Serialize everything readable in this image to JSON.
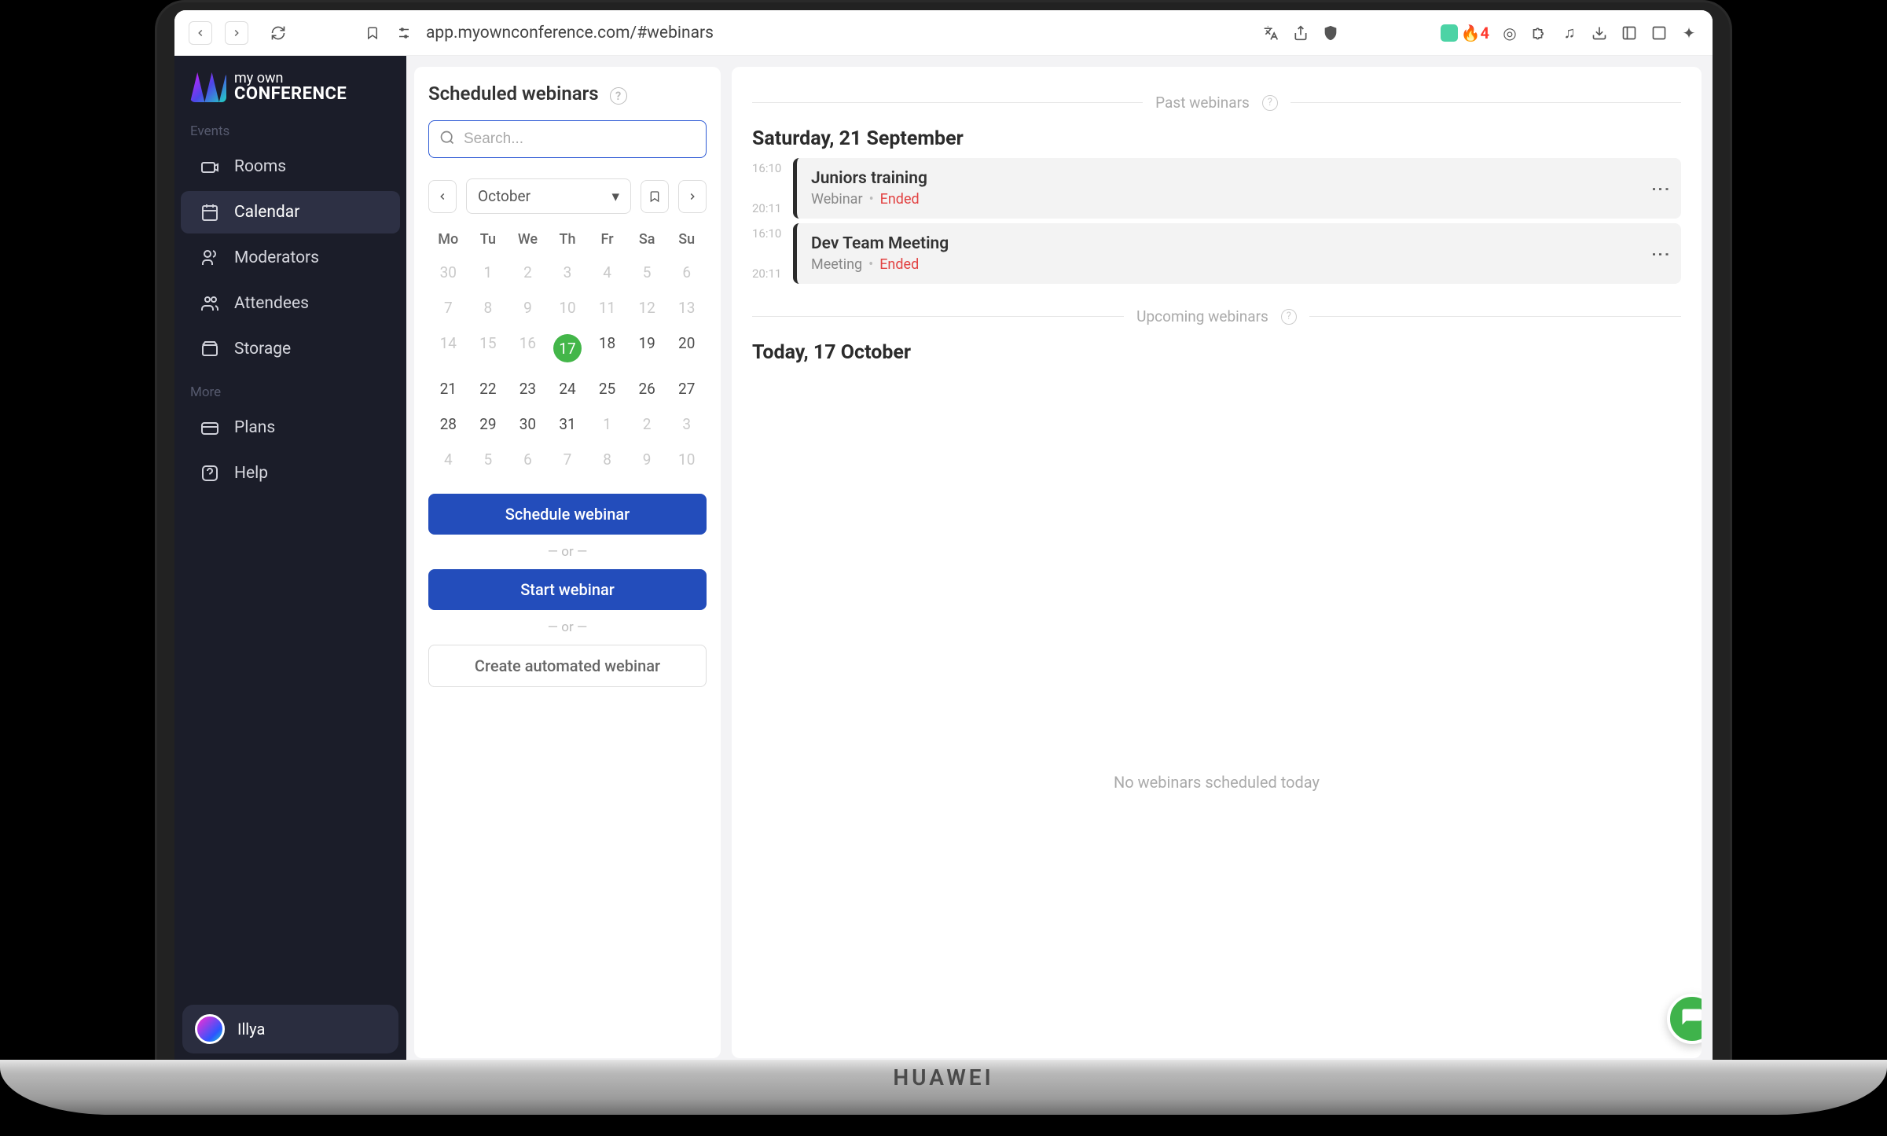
{
  "browser": {
    "url": "app.myownconference.com/#webinars",
    "ext_badge": "4",
    "laptop_brand": "HUAWEI"
  },
  "sidebar": {
    "logo_line1": "my own",
    "logo_line2": "CONFERENCE",
    "sections": {
      "events": "Events",
      "more": "More"
    },
    "items": {
      "rooms": "Rooms",
      "calendar": "Calendar",
      "moderators": "Moderators",
      "attendees": "Attendees",
      "storage": "Storage",
      "plans": "Plans",
      "help": "Help"
    },
    "user": "Illya"
  },
  "panel": {
    "title": "Scheduled webinars",
    "search_placeholder": "Search...",
    "month": "October",
    "dow": [
      "Mo",
      "Tu",
      "We",
      "Th",
      "Fr",
      "Sa",
      "Su"
    ],
    "weeks": [
      [
        {
          "n": 30,
          "m": true
        },
        {
          "n": 1,
          "m": true
        },
        {
          "n": 2,
          "m": true
        },
        {
          "n": 3,
          "m": true
        },
        {
          "n": 4,
          "m": true
        },
        {
          "n": 5,
          "m": true
        },
        {
          "n": 6,
          "m": true
        }
      ],
      [
        {
          "n": 7,
          "m": true
        },
        {
          "n": 8,
          "m": true
        },
        {
          "n": 9,
          "m": true
        },
        {
          "n": 10,
          "m": true
        },
        {
          "n": 11,
          "m": true
        },
        {
          "n": 12,
          "m": true
        },
        {
          "n": 13,
          "m": true
        }
      ],
      [
        {
          "n": 14,
          "m": true
        },
        {
          "n": 15,
          "m": true
        },
        {
          "n": 16,
          "m": true
        },
        {
          "n": 17,
          "today": true
        },
        {
          "n": 18
        },
        {
          "n": 19
        },
        {
          "n": 20
        }
      ],
      [
        {
          "n": 21
        },
        {
          "n": 22
        },
        {
          "n": 23
        },
        {
          "n": 24
        },
        {
          "n": 25
        },
        {
          "n": 26
        },
        {
          "n": 27
        }
      ],
      [
        {
          "n": 28
        },
        {
          "n": 29
        },
        {
          "n": 30
        },
        {
          "n": 31
        },
        {
          "n": 1,
          "m": true
        },
        {
          "n": 2,
          "m": true
        },
        {
          "n": 3,
          "m": true
        }
      ],
      [
        {
          "n": 4,
          "m": true
        },
        {
          "n": 5,
          "m": true
        },
        {
          "n": 6,
          "m": true
        },
        {
          "n": 7,
          "m": true
        },
        {
          "n": 8,
          "m": true
        },
        {
          "n": 9,
          "m": true
        },
        {
          "n": 10,
          "m": true
        }
      ]
    ],
    "schedule_btn": "Schedule webinar",
    "start_btn": "Start webinar",
    "auto_btn": "Create automated webinar",
    "or": "— or —"
  },
  "main": {
    "past_label": "Past webinars",
    "upcoming_label": "Upcoming webinars",
    "past_date": "Saturday, 21 September",
    "upcoming_date": "Today, 17 October",
    "no_events": "No webinars scheduled today",
    "events": [
      {
        "start": "16:10",
        "end": "20:11",
        "title": "Juniors training",
        "type": "Webinar",
        "status": "Ended"
      },
      {
        "start": "16:10",
        "end": "20:11",
        "title": "Dev Team Meeting",
        "type": "Meeting",
        "status": "Ended"
      }
    ]
  }
}
